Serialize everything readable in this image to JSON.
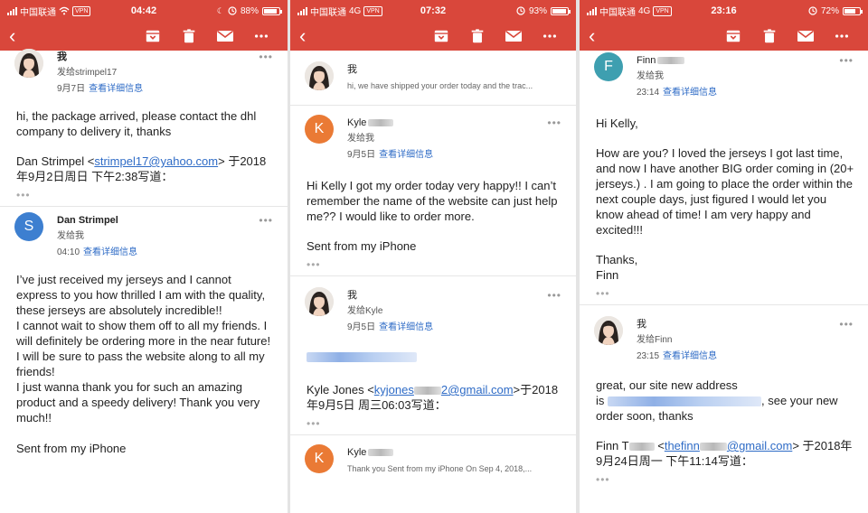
{
  "colors": {
    "accent": "#d9473b",
    "link": "#2e6bc6",
    "avatar_s": "#3d7fd0",
    "avatar_k": "#ea7a35",
    "avatar_f": "#3e9fb0"
  },
  "icons": [
    "back-arrow-icon",
    "archive-icon",
    "trash-icon",
    "mail-icon",
    "more-icon"
  ],
  "common": {
    "carrier": "中国联通",
    "vpn": "VPN",
    "back_icon": "‹",
    "more_dots": "•••",
    "details": "查看详细信息",
    "ellipsis": "•••"
  },
  "panel1": {
    "status": {
      "network": "",
      "time": "04:42",
      "battery": "88%",
      "battery_level": 0.88
    },
    "msg1": {
      "sender": "我",
      "to": "发给strimpel17",
      "date": "9月7日",
      "body1": "hi, the package arrived, please contact the dhl company to delivery it, thanks",
      "quote_pre": "Dan Strimpel <",
      "quote_email": "strimpel17@yahoo.com",
      "quote_post": "> 于2018年9月2日周日 下午2:38写道："
    },
    "msg2": {
      "avatar_letter": "S",
      "sender": "Dan Strimpel",
      "to": "发给我",
      "date": "04:10",
      "body1": "I’ve just received my jerseys and I cannot express to you how thrilled I am with the quality, these jerseys are absolutely incredible!!",
      "body2": "I cannot wait to show them off to all my friends. I will definitely be ordering more in the near future!",
      "body3": "I will be sure to pass the website along to all my friends!",
      "body4": "I just wanna thank you for such an amazing product and a speedy delivery! Thank you very much!!",
      "body5": "Sent from my iPhone"
    }
  },
  "panel2": {
    "status": {
      "network": "4G",
      "time": "07:32",
      "battery": "93%",
      "battery_level": 0.93
    },
    "msg1": {
      "sender": "我",
      "snippet": "hi, we have shipped your order today and the trac..."
    },
    "msg2": {
      "avatar_letter": "K",
      "sender": "Kyle",
      "to": "发给我",
      "date": "9月5日",
      "body1": "Hi Kelly I got my order today very happy!! I can’t remember the name of the website can just help me?? I would like to order more.",
      "body2": "Sent from my iPhone"
    },
    "msg3": {
      "sender": "我",
      "to": "发给Kyle",
      "date": "9月5日",
      "quote_pre": "Kyle Jones <",
      "quote_email": "kyjones",
      "quote_email2": "2@gmail.com",
      "quote_post": ">于2018年9月5日 周三06:03写道："
    },
    "msg4": {
      "avatar_letter": "K",
      "sender": "Kyle",
      "snippet": "Thank you Sent from my iPhone On Sep 4, 2018,..."
    }
  },
  "panel3": {
    "status": {
      "network": "4G",
      "time": "23:16",
      "battery": "72%",
      "battery_level": 0.72
    },
    "msg1": {
      "avatar_letter": "F",
      "sender": "Finn",
      "to": "发给我",
      "date": "23:14",
      "body1": "Hi Kelly,",
      "body2": "How are you? I loved the jerseys I got last time, and now I have another BIG order coming in (20+ jerseys.) .  I am going to place the order within the next couple days, just figured I would let you know ahead of time! I am very happy and excited!!!",
      "body3a": "Thanks,",
      "body3b": "Finn"
    },
    "msg2": {
      "sender": "我",
      "to": "发给Finn",
      "date": "23:15",
      "body1a": "great, our site new address",
      "body1b": "is",
      "body1c": ", see your new order soon, thanks",
      "quote_pre": "Finn T",
      "quote_lt": " <",
      "quote_email": "thefinn",
      "quote_email2": "@gmail.com",
      "quote_post": "> 于2018年9月24日周一 下午11:14写道："
    }
  }
}
